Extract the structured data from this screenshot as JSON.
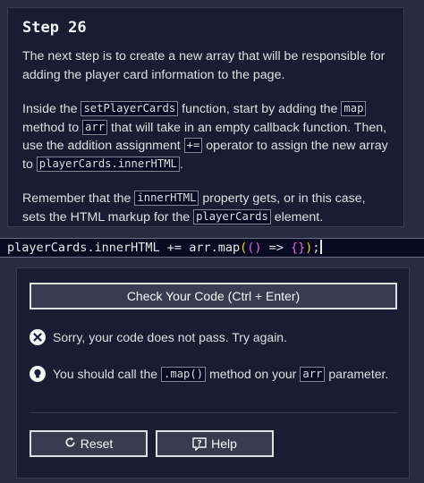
{
  "step": {
    "title": "Step 26",
    "p1": "The next step is to create a new array that will be responsible for adding the player card information to the page.",
    "p2": {
      "t1": "Inside the ",
      "c1": "setPlayerCards",
      "t2": " function, start by adding the ",
      "c2": "map",
      "t3": " method to ",
      "c3": "arr",
      "t4": " that will take in an empty callback function. Then, use the addition assignment ",
      "c4": "+=",
      "t5": " operator to assign the new array to ",
      "c5": "playerCards.innerHTML",
      "t6": "."
    },
    "p3": {
      "t1": "Remember that the ",
      "c1": "innerHTML",
      "t2": " property gets, or in this case, sets the HTML markup for the ",
      "c2": "playerCards",
      "t3": " element."
    }
  },
  "editor": {
    "code_prefix": "playerCards.innerHTML += arr.map",
    "paren_open": "(",
    "inner_parens": "()",
    "arrow": " => ",
    "braces": "{}",
    "paren_close": ")",
    "semicolon": ";"
  },
  "output": {
    "check_button": "Check Your Code (Ctrl + Enter)",
    "error_text": "Sorry, your code does not pass. Try again.",
    "hint": {
      "t1": "You should call the ",
      "c1": ".map()",
      "t2": " method on your ",
      "c2": "arr",
      "t3": " parameter."
    },
    "reset_button": "Reset",
    "help_button": "Help",
    "help_glyph": "?"
  }
}
